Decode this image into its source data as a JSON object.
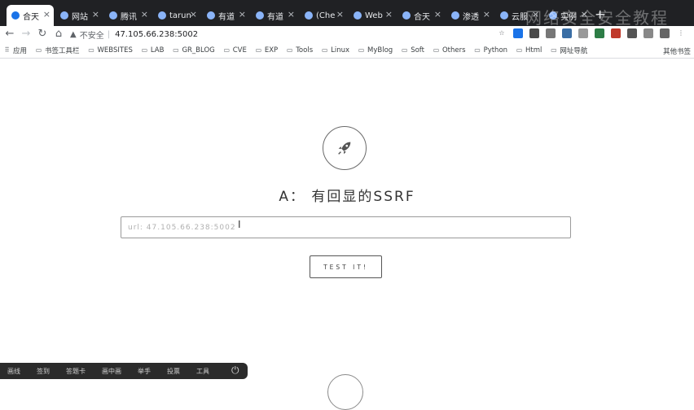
{
  "tabs": [
    {
      "label": "合天",
      "active": true
    },
    {
      "label": "网站"
    },
    {
      "label": "腾讯"
    },
    {
      "label": "tarun"
    },
    {
      "label": "有道"
    },
    {
      "label": "有道"
    },
    {
      "label": "(Che"
    },
    {
      "label": "Web"
    },
    {
      "label": "合天"
    },
    {
      "label": "渗透"
    },
    {
      "label": "云服"
    },
    {
      "label": "实例"
    }
  ],
  "new_tab": "+",
  "watermark": "网络安全安全教程",
  "toolbar": {
    "back": "←",
    "forward": "→",
    "reload": "↻",
    "home": "⌂",
    "security_label": "不安全",
    "url": "47.105.66.238:5002"
  },
  "bookmarks": [
    {
      "label": "应用",
      "icon": "apps-grid-icon"
    },
    {
      "label": "书签工具栏",
      "icon": "folder-icon"
    },
    {
      "label": "WEBSITES",
      "icon": "folder-icon"
    },
    {
      "label": "LAB",
      "icon": "folder-icon"
    },
    {
      "label": "GR_BLOG",
      "icon": "folder-icon"
    },
    {
      "label": "CVE",
      "icon": "folder-icon"
    },
    {
      "label": "EXP",
      "icon": "folder-icon"
    },
    {
      "label": "Tools",
      "icon": "folder-icon"
    },
    {
      "label": "Linux",
      "icon": "folder-icon"
    },
    {
      "label": "MyBlog",
      "icon": "folder-icon"
    },
    {
      "label": "Soft",
      "icon": "folder-icon"
    },
    {
      "label": "Others",
      "icon": "folder-icon"
    },
    {
      "label": "Python",
      "icon": "folder-icon"
    },
    {
      "label": "Html",
      "icon": "folder-icon"
    },
    {
      "label": "网址导航",
      "icon": "folder-icon"
    }
  ],
  "bookmarks_other": "其他书签",
  "main": {
    "heading": "A： 有回显的SSRF",
    "input_placeholder": "url: 47.105.66.238:5002",
    "button_label": "TEST IT!",
    "icon": "rocket-icon"
  },
  "taskbar": [
    "画线",
    "签到",
    "答题卡",
    "画中画",
    "举手",
    "投票",
    "工具"
  ],
  "colors": {
    "tabstrip": "#202124",
    "taskbar": "#2b2b2b",
    "accent": "#333333"
  }
}
